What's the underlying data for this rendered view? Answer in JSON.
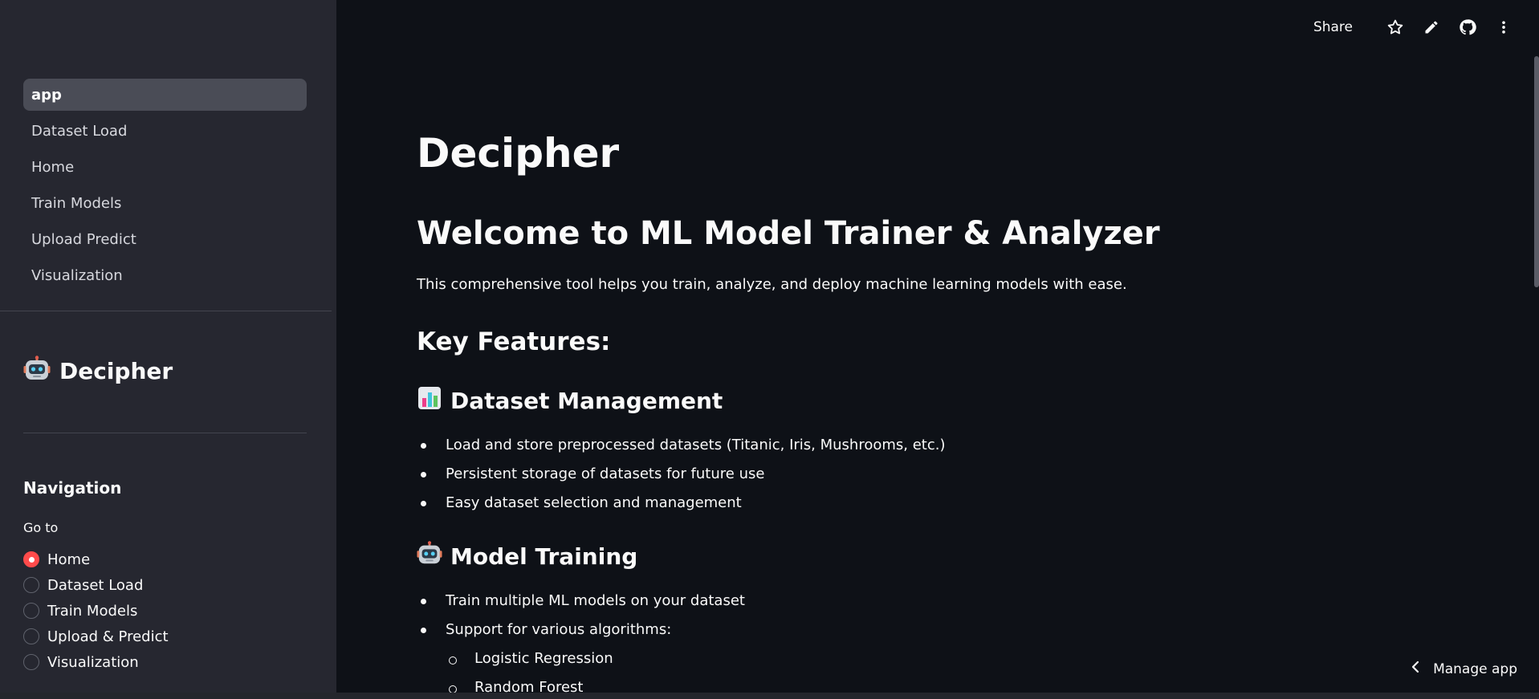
{
  "sidebar": {
    "pages": [
      {
        "label": "app",
        "active": true
      },
      {
        "label": "Dataset Load",
        "active": false
      },
      {
        "label": "Home",
        "active": false
      },
      {
        "label": "Train Models",
        "active": false
      },
      {
        "label": "Upload Predict",
        "active": false
      },
      {
        "label": "Visualization",
        "active": false
      }
    ],
    "brand_icon": "robot-icon",
    "brand_title": "Decipher",
    "navigation_heading": "Navigation",
    "goto_label": "Go to",
    "radio_options": [
      {
        "label": "Home",
        "checked": true
      },
      {
        "label": "Dataset Load",
        "checked": false
      },
      {
        "label": "Train Models",
        "checked": false
      },
      {
        "label": "Upload & Predict",
        "checked": false
      },
      {
        "label": "Visualization",
        "checked": false
      }
    ]
  },
  "toolbar": {
    "share_label": "Share",
    "icons": [
      "star-icon",
      "pencil-icon",
      "github-icon",
      "more-vertical-icon"
    ]
  },
  "main": {
    "title": "Decipher",
    "welcome_heading": "Welcome to ML Model Trainer & Analyzer",
    "intro": "This comprehensive tool helps you train, analyze, and deploy machine learning models with ease.",
    "features_heading": "Key Features:",
    "sections": [
      {
        "icon": "bar-chart-icon",
        "title": "Dataset Management",
        "items": [
          "Load and store preprocessed datasets (Titanic, Iris, Mushrooms, etc.)",
          "Persistent storage of datasets for future use",
          "Easy dataset selection and management"
        ]
      },
      {
        "icon": "robot-icon",
        "title": "Model Training",
        "items": [
          "Train multiple ML models on your dataset",
          "Support for various algorithms:"
        ],
        "sub_items": [
          "Logistic Regression",
          "Random Forest"
        ]
      }
    ]
  },
  "footer": {
    "manage_app_label": "Manage app"
  },
  "colors": {
    "background": "#0e1117",
    "sidebar": "#262730",
    "accent": "#ff4b4b",
    "text": "#fafafa"
  }
}
